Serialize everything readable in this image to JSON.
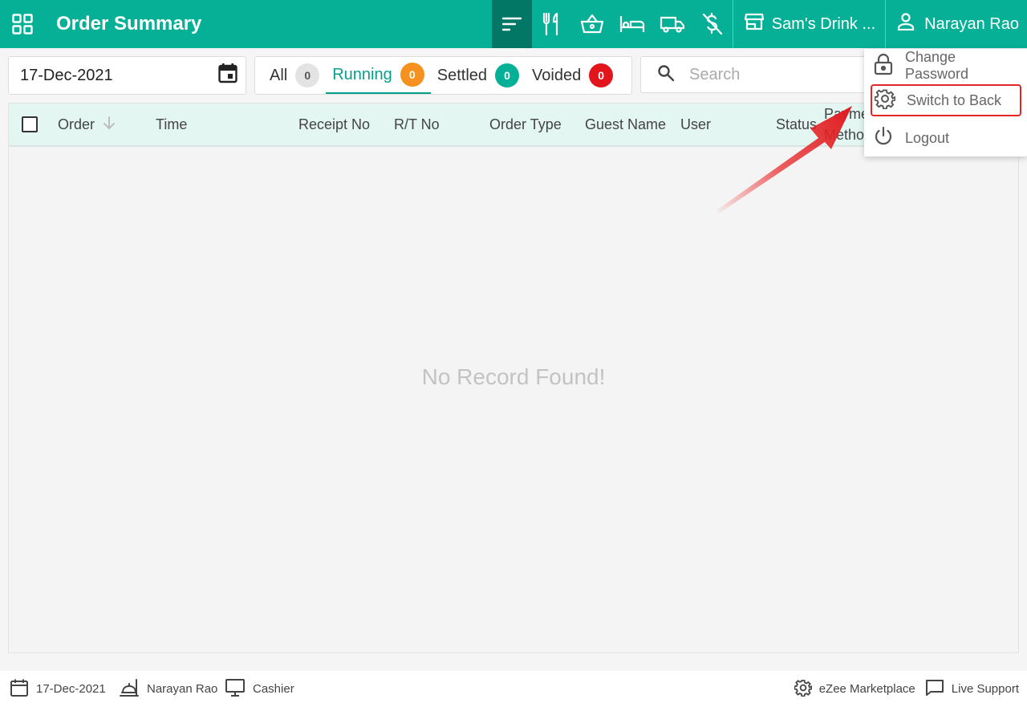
{
  "header": {
    "title": "Order Summary",
    "outlet": "Sam's Drink ...",
    "user": "Narayan Rao",
    "nav_icons": [
      "orders-list-icon",
      "dine-in-icon",
      "basket-icon",
      "room-service-icon",
      "delivery-icon",
      "no-payment-icon"
    ]
  },
  "filters": {
    "date": "17-Dec-2021",
    "tabs": [
      {
        "label": "All",
        "count": "0"
      },
      {
        "label": "Running",
        "count": "0"
      },
      {
        "label": "Settled",
        "count": "0"
      },
      {
        "label": "Voided",
        "count": "0"
      }
    ],
    "search_placeholder": "Search"
  },
  "table": {
    "columns": [
      "Order",
      "Time",
      "Receipt No",
      "R/T No",
      "Order Type",
      "Guest Name",
      "User",
      "Status",
      "Payme",
      "Metho"
    ],
    "empty_message": "No Record Found!"
  },
  "user_menu": {
    "items": [
      "Change Password",
      "Switch to Back",
      "Logout"
    ]
  },
  "footer": {
    "date": "17-Dec-2021",
    "user": "Narayan Rao",
    "role": "Cashier",
    "marketplace": "eZee Marketplace",
    "support": "Live Support"
  },
  "colors": {
    "brand": "#06b097",
    "brand_dark": "#037766",
    "running": "#f6911f",
    "voided": "#e2141c",
    "highlight": "#e4262b"
  }
}
